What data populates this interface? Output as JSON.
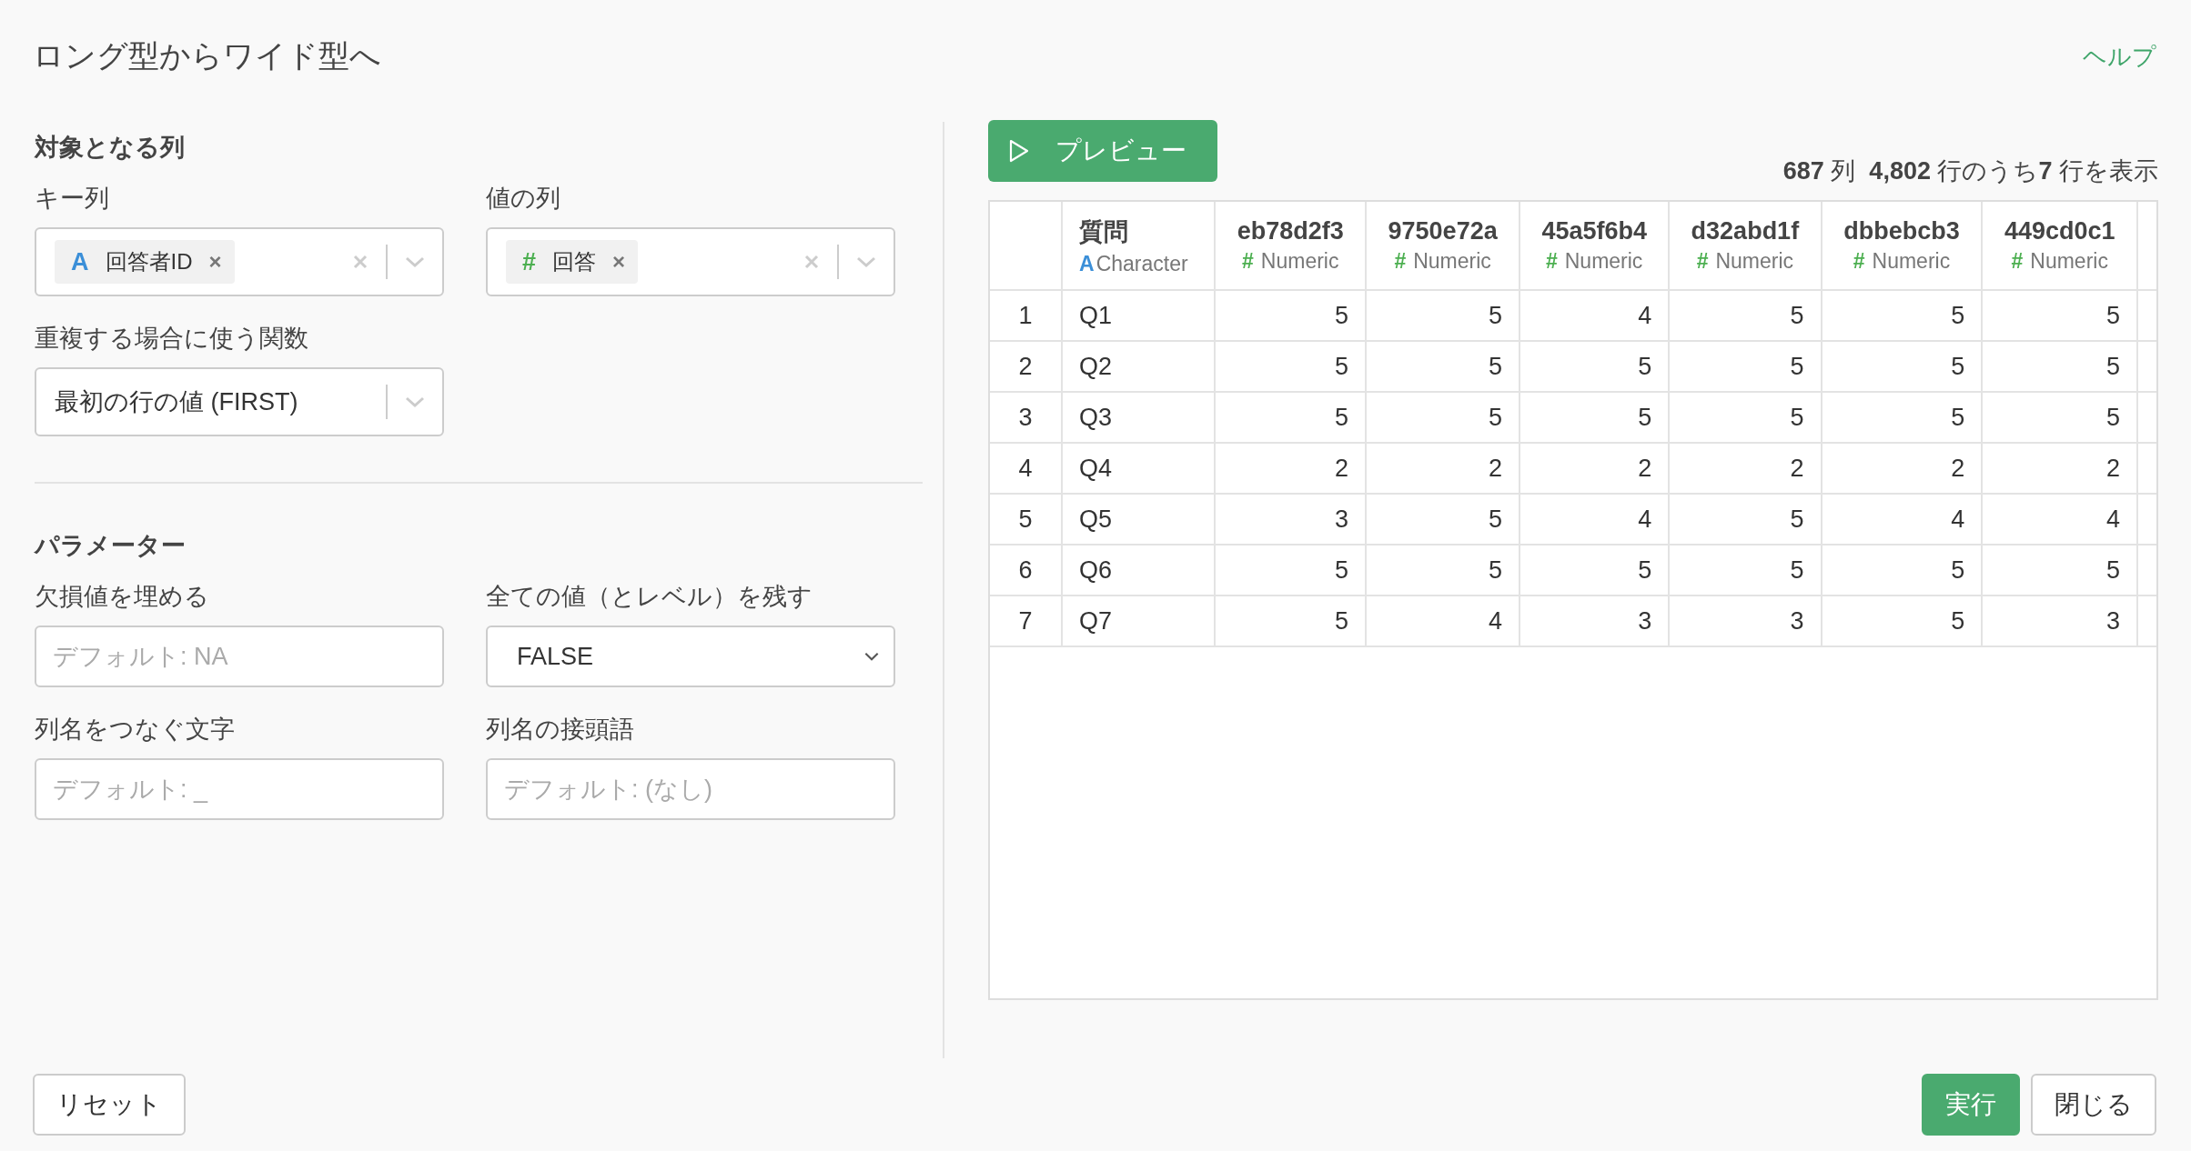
{
  "dialog": {
    "title": "ロング型からワイド型へ",
    "help_link": "ヘルプ"
  },
  "sections": [
    {
      "heading": "対象となる列",
      "fields": [
        {
          "label": "キー列",
          "kind": "tags",
          "chips": [
            {
              "kind": "character",
              "icon": "A",
              "text": "回答者ID",
              "remove": "×"
            }
          ]
        },
        {
          "label": "値の列",
          "kind": "tags",
          "chips": [
            {
              "kind": "numeric",
              "icon": "#",
              "text": "回答",
              "remove": "×"
            }
          ]
        },
        {
          "label": "重複する場合に使う関数",
          "kind": "select",
          "value": "最初の行の値 (FIRST)"
        }
      ]
    },
    {
      "heading": "パラメーター",
      "fields": [
        {
          "label": "欠損値を埋める",
          "kind": "text",
          "placeholder": "デフォルト: NA"
        },
        {
          "label": "全ての値（とレベル）を残す",
          "kind": "dropdown",
          "value": "FALSE"
        },
        {
          "label": "列名をつなぐ文字",
          "kind": "text",
          "placeholder": "デフォルト: _"
        },
        {
          "label": "列名の接頭語",
          "kind": "text",
          "placeholder": "デフォルト: (なし)"
        }
      ]
    }
  ],
  "preview_button": "プレビュー",
  "summary": "**687** 列  **4,802** 行のうち**7** 行を表示",
  "table": {
    "columns": [
      {
        "name": "質問",
        "kind": "character",
        "icon": "A",
        "type_label": "Character"
      },
      {
        "name": "eb78d2f3",
        "kind": "numeric",
        "icon": "#",
        "type_label": "Numeric"
      },
      {
        "name": "9750e72a",
        "kind": "numeric",
        "icon": "#",
        "type_label": "Numeric"
      },
      {
        "name": "45a5f6b4",
        "kind": "numeric",
        "icon": "#",
        "type_label": "Numeric"
      },
      {
        "name": "d32abd1f",
        "kind": "numeric",
        "icon": "#",
        "type_label": "Numeric"
      },
      {
        "name": "dbbebcb3",
        "kind": "numeric",
        "icon": "#",
        "type_label": "Numeric"
      },
      {
        "name": "449cd0c1",
        "kind": "numeric",
        "icon": "#",
        "type_label": "Numeric"
      }
    ],
    "rows": [
      {
        "num": "1",
        "cells": [
          "Q1",
          "5",
          "5",
          "4",
          "5",
          "5",
          "5"
        ]
      },
      {
        "num": "2",
        "cells": [
          "Q2",
          "5",
          "5",
          "5",
          "5",
          "5",
          "5"
        ]
      },
      {
        "num": "3",
        "cells": [
          "Q3",
          "5",
          "5",
          "5",
          "5",
          "5",
          "5"
        ]
      },
      {
        "num": "4",
        "cells": [
          "Q4",
          "2",
          "2",
          "2",
          "2",
          "2",
          "2"
        ]
      },
      {
        "num": "5",
        "cells": [
          "Q5",
          "3",
          "5",
          "4",
          "5",
          "4",
          "4"
        ]
      },
      {
        "num": "6",
        "cells": [
          "Q6",
          "5",
          "5",
          "5",
          "5",
          "5",
          "5"
        ]
      },
      {
        "num": "7",
        "cells": [
          "Q7",
          "5",
          "4",
          "3",
          "3",
          "5",
          "3"
        ]
      }
    ]
  },
  "footer": {
    "reset_button": "リセット",
    "run_button": "実行",
    "close_button": "閉じる"
  }
}
